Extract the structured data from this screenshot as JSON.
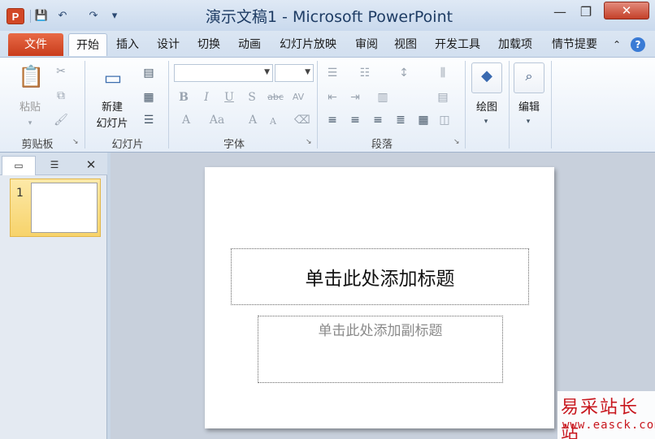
{
  "window": {
    "title": "演示文稿1 - Microsoft PowerPoint",
    "app_icon_letter": "P"
  },
  "qat": {
    "save": "💾",
    "undo": "↶",
    "redo": "↷",
    "customize": "▾"
  },
  "window_controls": {
    "minimize": "—",
    "restore": "❐",
    "close": "✕"
  },
  "tabs": {
    "file": "文件",
    "items": [
      "开始",
      "插入",
      "设计",
      "切换",
      "动画",
      "幻灯片放映",
      "审阅",
      "视图",
      "开发工具",
      "加载项",
      "情节提要"
    ],
    "active": "开始",
    "collapse_icon": "⌃",
    "help_icon": "?"
  },
  "ribbon": {
    "clipboard": {
      "label": "剪贴板",
      "paste": "粘贴"
    },
    "slides": {
      "label": "幻灯片",
      "new_slide_line1": "新建",
      "new_slide_line2": "幻灯片"
    },
    "font": {
      "label": "字体",
      "font_name": "",
      "font_size": ""
    },
    "paragraph": {
      "label": "段落"
    },
    "drawing": {
      "label": "绘图"
    },
    "editing": {
      "label": "编辑"
    }
  },
  "panel": {
    "slide_number": "1"
  },
  "slide": {
    "title_placeholder": "单击此处添加标题",
    "subtitle_placeholder": "单击此处添加副标题"
  },
  "watermark": {
    "title": "易采站长站",
    "url": "www.easck.com"
  },
  "colors": {
    "file_tab": "#d24726",
    "accent": "#1e3c64",
    "thumb_highlight": "#f7d36b"
  }
}
